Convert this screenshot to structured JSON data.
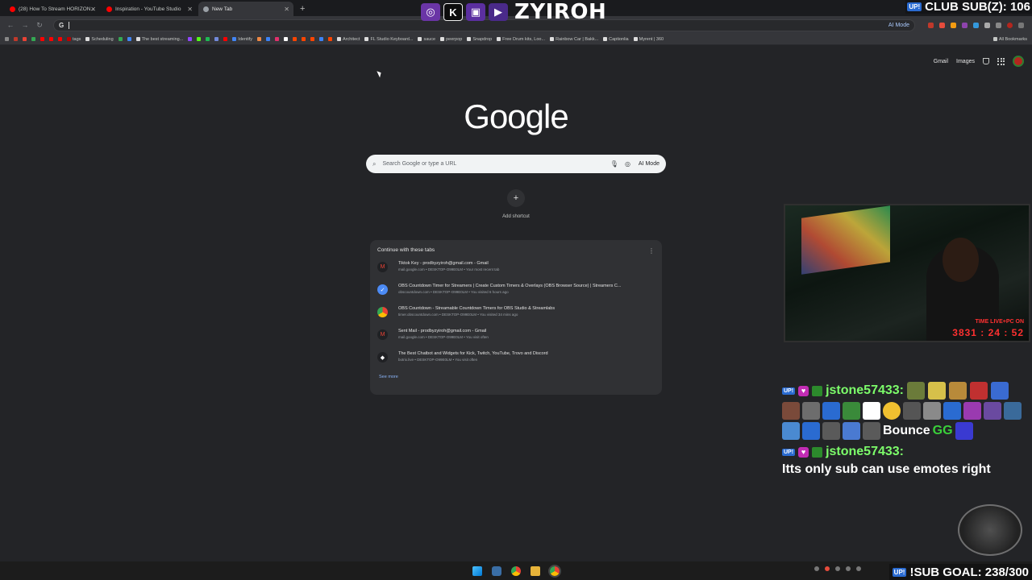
{
  "tabs": [
    {
      "label": "(28) How To Stream HORIZON...",
      "color": "#ff0000"
    },
    {
      "label": "Inspiration - YouTube Studio",
      "color": "#ff0000"
    },
    {
      "label": "New Tab",
      "color": "#9aa0a6",
      "active": true
    }
  ],
  "toolbar": {
    "omnibox_prefix": "G",
    "ai_mode": "AI Mode"
  },
  "bookmarks": [
    {
      "label": "",
      "color": "#888"
    },
    {
      "label": "tags",
      "color": "#c44"
    },
    {
      "label": "Scheduling",
      "color": "#ddd"
    },
    {
      "label": "The best streaming...",
      "color": "#e8e8e8"
    },
    {
      "label": "Identify",
      "color": "#4285f4"
    },
    {
      "label": "Architect",
      "color": "#ddd"
    },
    {
      "label": "FL Studio Keyboard...",
      "color": "#ddd"
    },
    {
      "label": "sauce",
      "color": "#ddd"
    },
    {
      "label": "peerpop",
      "color": "#ddd"
    },
    {
      "label": "Snapdrop",
      "color": "#ddd"
    },
    {
      "label": "Free Drum kits, Loo...",
      "color": "#ddd"
    },
    {
      "label": "Rainbow Car | Bakk...",
      "color": "#ddd"
    },
    {
      "label": "Captionlia",
      "color": "#ddd"
    },
    {
      "label": "Myrent | 360",
      "color": "#ddd"
    }
  ],
  "bookmarks_all": "All Bookmarks",
  "top_links": {
    "gmail": "Gmail",
    "images": "Images"
  },
  "logo": "Google",
  "search": {
    "placeholder": "Search Google or type a URL",
    "ai_mode": "AI Mode"
  },
  "shortcut": {
    "plus": "+",
    "label": "Add shortcut"
  },
  "continue": {
    "title": "Continue with these tabs",
    "items": [
      {
        "title": "Tiktok Key - prodbyzyiroh@gmail.com - Gmail",
        "sub": "mail.google.com • DESKTOP-O99E0LM • Your most recent tab",
        "icon": "gmail-icon",
        "icolor": "#ea4335"
      },
      {
        "title": "OBS Countdown Timer for Streamers | Create Custom Timers & Overlays (OBS Browser Source) | Streamers C...",
        "sub": "obscountdown.com • DESKTOP-O99E0LM • You visited 6 hours ago",
        "icon": "timer-icon",
        "icolor": "#4c8bf5"
      },
      {
        "title": "OBS Countdown - Streamable Countdown Timers for OBS Studio & Streamlabs",
        "sub": "timer.obscountdown.com • DESKTOP-O99E0LM • You visited 34 mins ago",
        "icon": "chrome-icon",
        "icolor": "#34a853"
      },
      {
        "title": "Sent Mail - prodbyzyiroh@gmail.com - Gmail",
        "sub": "mail.google.com • DESKTOP-O99E0LM • You visit often",
        "icon": "gmail-icon",
        "icolor": "#ea4335"
      },
      {
        "title": "The Best Chatbot and Widgets for Kick, Twitch, YouTube, Trovo and Discord",
        "sub": "botrix.live • DESKTOP-O99E0LM • You visit often",
        "icon": "bot-icon",
        "icolor": "#ffffff"
      }
    ],
    "see_more": "See more"
  },
  "overlay": {
    "brand": "ZYIROH",
    "club_sub": "CLUB SUB(Z): 106",
    "up_badge": "UP!",
    "timer_label": "TIME LIVE+PC ON",
    "timer_value": "3831 : 24 : 52",
    "chat": [
      {
        "user": "jstone57433:",
        "emote_text_1": "Bounce",
        "emote_text_2": "GG"
      },
      {
        "user": "jstone57433:",
        "message": "Itts only sub can use emotes right"
      }
    ],
    "goal": "!SUB GOAL: 238/300",
    "goal_badge": "UP!"
  }
}
